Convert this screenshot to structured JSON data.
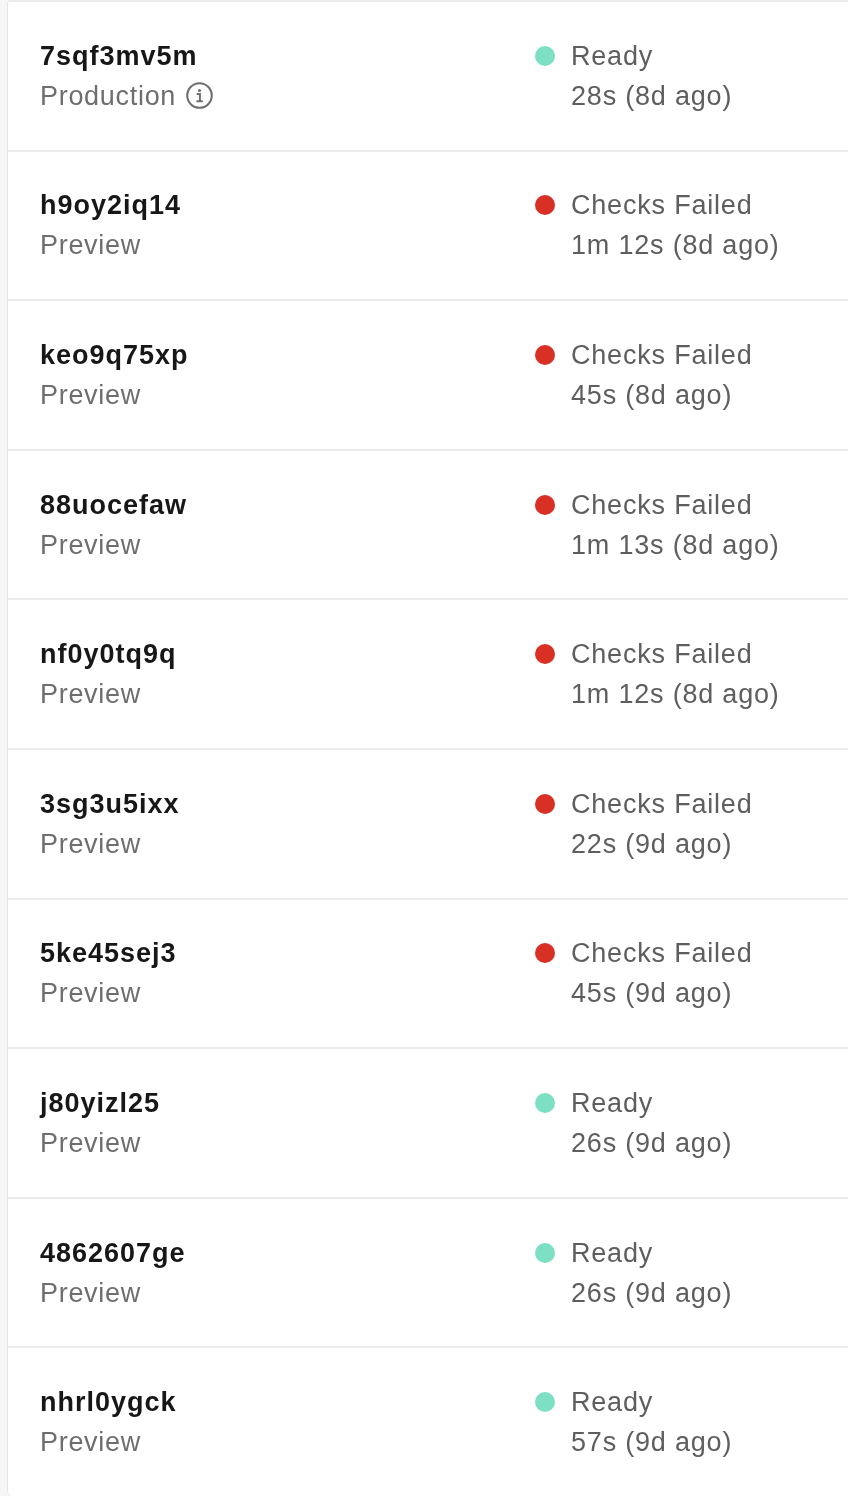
{
  "deployments": [
    {
      "id": "7sqf3mv5m",
      "environment": "Production",
      "info_icon": true,
      "status": "Ready",
      "color": "#7de0c4",
      "duration": "28s (8d ago)"
    },
    {
      "id": "h9oy2iq14",
      "environment": "Preview",
      "info_icon": false,
      "status": "Checks Failed",
      "color": "#d93025",
      "duration": "1m 12s (8d ago)"
    },
    {
      "id": "keo9q75xp",
      "environment": "Preview",
      "info_icon": false,
      "status": "Checks Failed",
      "color": "#d93025",
      "duration": "45s (8d ago)"
    },
    {
      "id": "88uocefaw",
      "environment": "Preview",
      "info_icon": false,
      "status": "Checks Failed",
      "color": "#d93025",
      "duration": "1m 13s (8d ago)"
    },
    {
      "id": "nf0y0tq9q",
      "environment": "Preview",
      "info_icon": false,
      "status": "Checks Failed",
      "color": "#d93025",
      "duration": "1m 12s (8d ago)"
    },
    {
      "id": "3sg3u5ixx",
      "environment": "Preview",
      "info_icon": false,
      "status": "Checks Failed",
      "color": "#d93025",
      "duration": "22s (9d ago)"
    },
    {
      "id": "5ke45sej3",
      "environment": "Preview",
      "info_icon": false,
      "status": "Checks Failed",
      "color": "#d93025",
      "duration": "45s (9d ago)"
    },
    {
      "id": "j80yizl25",
      "environment": "Preview",
      "info_icon": false,
      "status": "Ready",
      "color": "#7de0c4",
      "duration": "26s (9d ago)"
    },
    {
      "id": "4862607ge",
      "environment": "Preview",
      "info_icon": false,
      "status": "Ready",
      "color": "#7de0c4",
      "duration": "26s (9d ago)"
    },
    {
      "id": "nhrl0ygck",
      "environment": "Preview",
      "info_icon": false,
      "status": "Ready",
      "color": "#7de0c4",
      "duration": "57s (9d ago)"
    }
  ]
}
